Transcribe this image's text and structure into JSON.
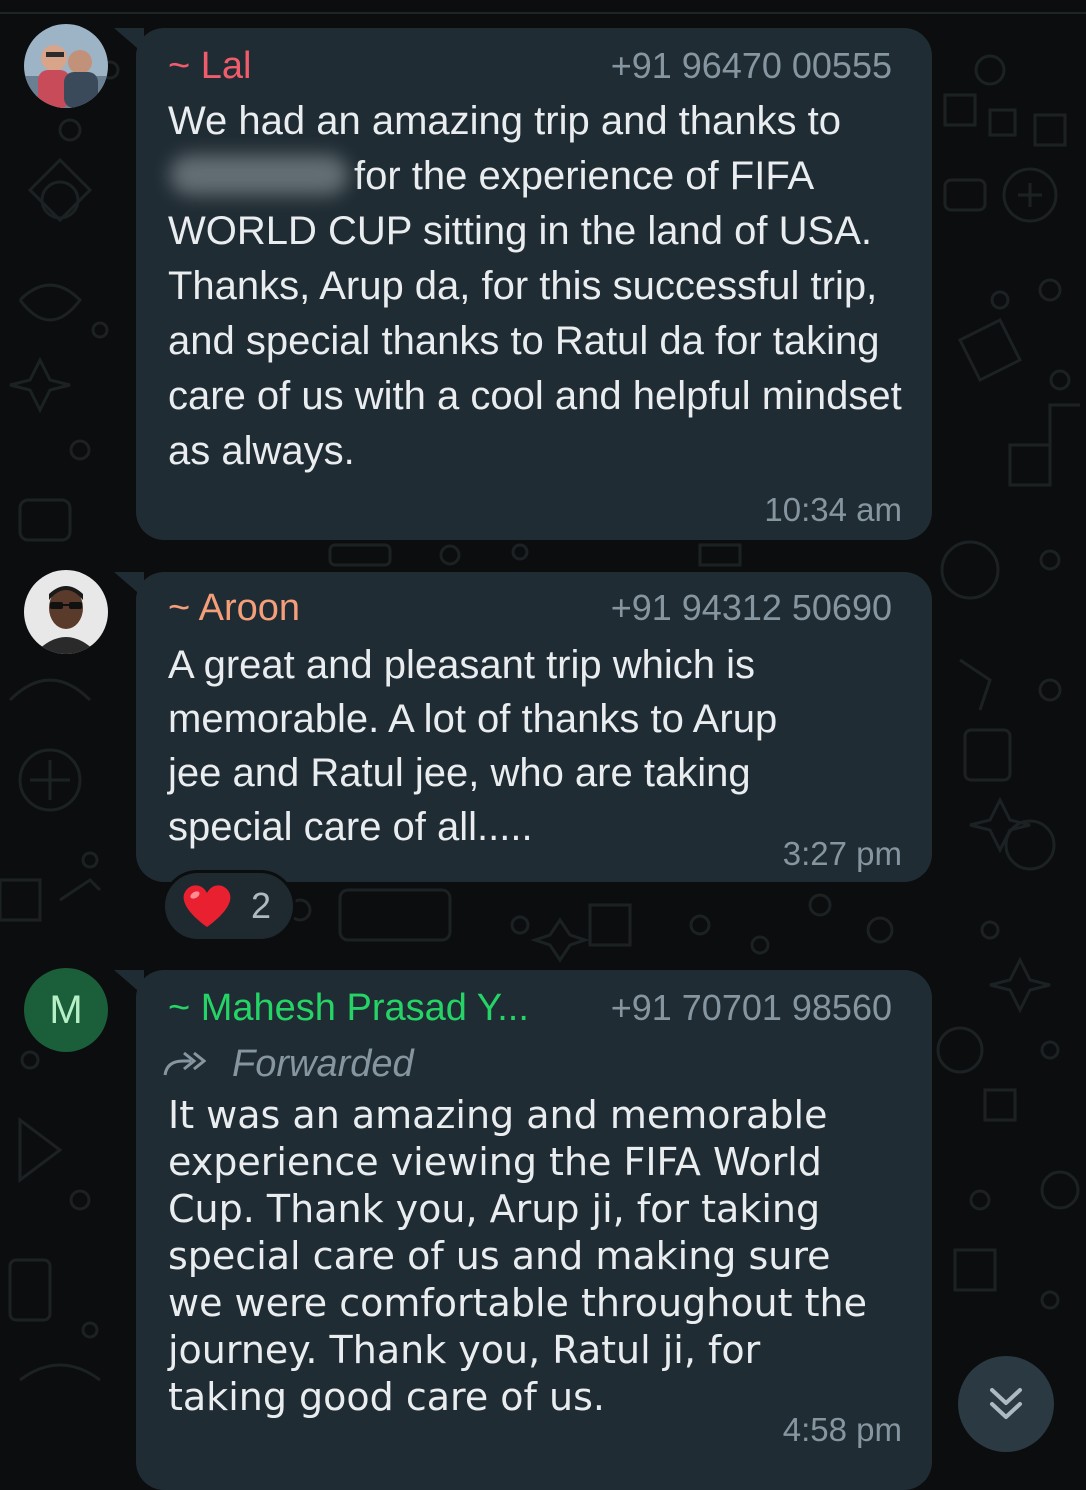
{
  "messages": [
    {
      "sender": "~ Lal",
      "phone": "+91 96470 00555",
      "text_before_redaction": "We had an amazing trip and thanks to",
      "text_after_redaction": "for the experience of FIFA WORLD CUP sitting in the land of USA. Thanks, Arup da, for this successful trip, and special thanks to Ratul da for taking care of us with a cool and helpful mindset as always.",
      "time": "10:34 am",
      "sender_color": "#f15c6d"
    },
    {
      "sender": "~ Aroon",
      "phone": "+91 94312 50690",
      "text": "A great and pleasant trip which is memorable. A lot of thanks to Arup jee and Ratul jee, who are taking special care of all.....",
      "time": "3:27 pm",
      "sender_color": "#f59e7a",
      "reaction": {
        "emoji": "❤️",
        "count": "2"
      }
    },
    {
      "avatar_letter": "M",
      "sender": "~ Mahesh Prasad Y...",
      "phone": "+91 70701 98560",
      "forwarded_label": "Forwarded",
      "text": "It was an amazing and memorable experience viewing the FIFA World Cup. Thank you, Arup ji, for taking special care of us and making sure we were comfortable throughout the journey. Thank you, Ratul ji, for taking good care of us.",
      "time": "4:58 pm",
      "sender_color": "#25d366"
    }
  ],
  "icons": {
    "scroll_button": "double-chevron-down-icon",
    "forwarded": "forward-arrow-icon"
  },
  "colors": {
    "background": "#0b0d0e",
    "bubble": "#202c33",
    "primary_text": "#e9edef",
    "secondary_text": "#8696a0"
  }
}
